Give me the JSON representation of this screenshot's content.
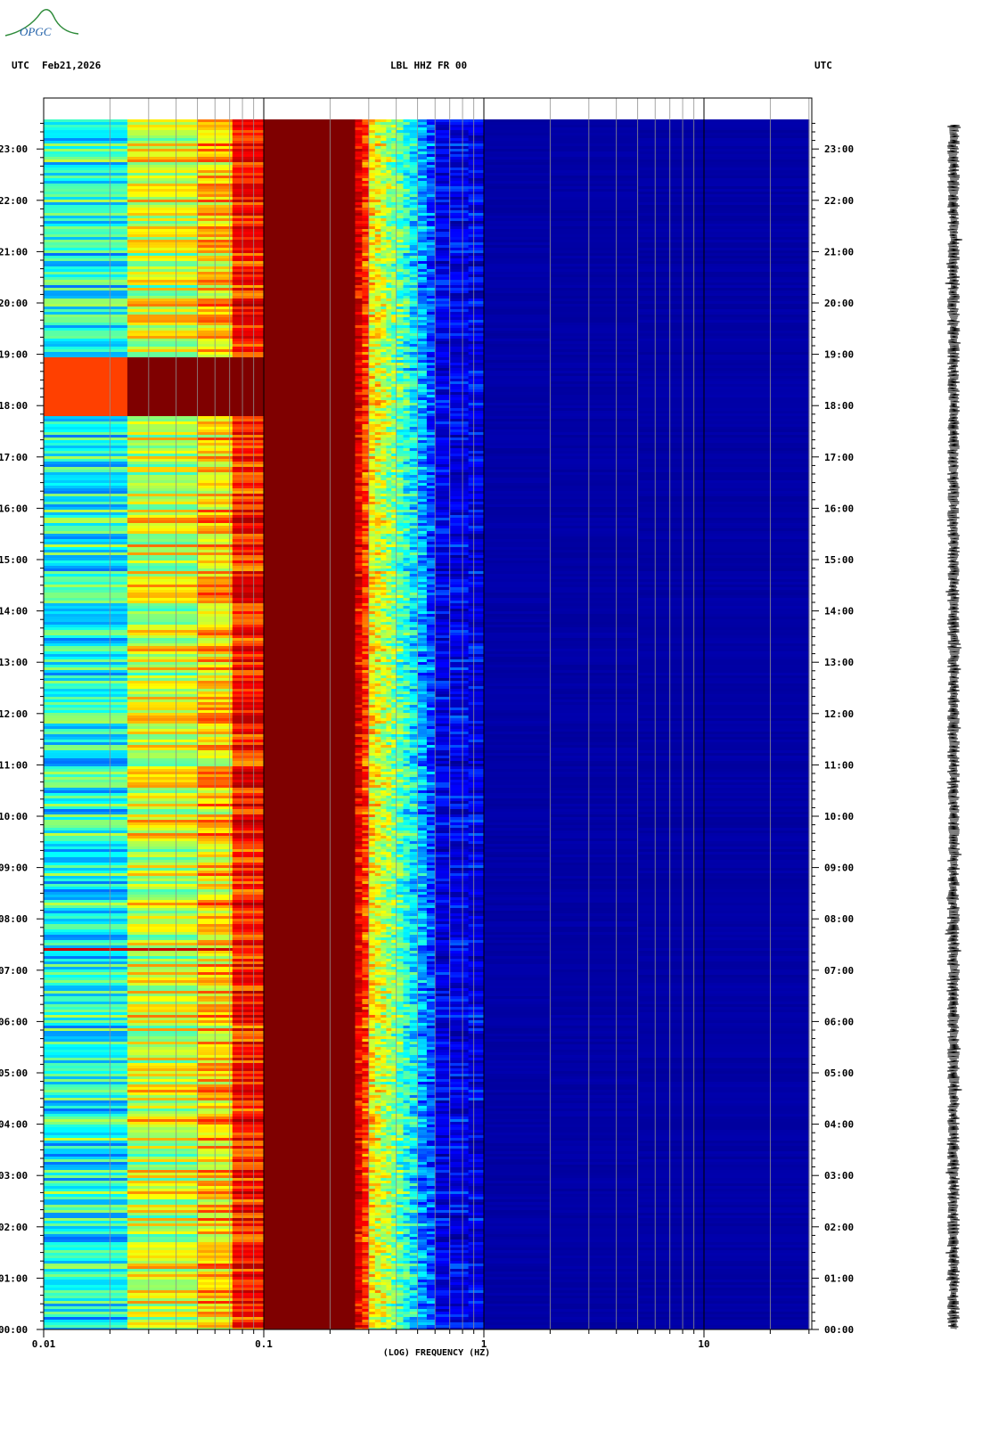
{
  "logo": {
    "text": "OPGC",
    "colors": {
      "ring": "#2e8b3a",
      "text": "#1f5fa8"
    }
  },
  "header": {
    "left_tz": "UTC",
    "date": "Feb21,2026",
    "station": "LBL HHZ FR 00",
    "right_tz": "UTC"
  },
  "chart_data": {
    "type": "heatmap",
    "xlabel": "(LOG) FREQUENCY (HZ)",
    "xscale": "log",
    "xlim": [
      0.01,
      30
    ],
    "x_tick_labels": [
      "0.01",
      "0.1",
      "1",
      "10"
    ],
    "x_ticks": [
      0.01,
      0.1,
      1,
      10
    ],
    "ylim": [
      "00:00",
      "23:35"
    ],
    "y_tick_labels": [
      "00:00",
      "01:00",
      "02:00",
      "03:00",
      "04:00",
      "05:00",
      "06:00",
      "07:00",
      "08:00",
      "09:00",
      "10:00",
      "11:00",
      "12:00",
      "13:00",
      "14:00",
      "15:00",
      "16:00",
      "17:00",
      "18:00",
      "19:00",
      "20:00",
      "21:00",
      "22:00",
      "23:00"
    ],
    "colormap": [
      "#00007f",
      "#0000ff",
      "#00ffff",
      "#ffff00",
      "#ff0000",
      "#7f0000"
    ],
    "frequency_bands": [
      {
        "range_hz": [
          0.01,
          0.024
        ],
        "level": "cyan"
      },
      {
        "range_hz": [
          0.024,
          0.05
        ],
        "level": "yellow-green"
      },
      {
        "range_hz": [
          0.05,
          0.072
        ],
        "level": "yellow-orange"
      },
      {
        "range_hz": [
          0.072,
          0.1
        ],
        "level": "red"
      },
      {
        "range_hz": [
          0.1,
          0.3
        ],
        "level": "dark red (microseism peak)"
      },
      {
        "range_hz": [
          0.3,
          0.6
        ],
        "level": "yellow to cyan transition"
      },
      {
        "range_hz": [
          0.6,
          30
        ],
        "level": "dark blue"
      }
    ],
    "notable_events": [
      {
        "time_range": [
          "17:50",
          "18:55"
        ],
        "range_hz": [
          0.01,
          0.1
        ],
        "description": "high energy event"
      },
      {
        "time_range": [
          "07:25",
          "07:30"
        ],
        "range_hz": [
          0.01,
          0.07
        ],
        "description": "red streak"
      }
    ],
    "grid": true
  }
}
